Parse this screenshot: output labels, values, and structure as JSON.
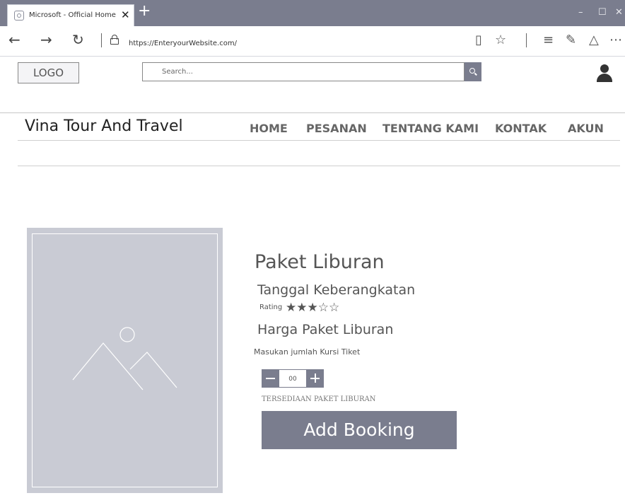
{
  "browser": {
    "tab_title": "Microsoft - Official Home",
    "tab_close": "✕",
    "new_tab": "+",
    "url": "https://EnteryourWebsite.com/",
    "window_controls": [
      "–",
      "☐",
      "✕"
    ],
    "icons": [
      "back-arrow-icon",
      "forward-arrow-icon",
      "refresh-icon",
      "lock-icon",
      "reading-view-icon",
      "favorite-star-icon",
      "hub-icon",
      "web-note-icon",
      "share-icon",
      "more-icon"
    ]
  },
  "header": {
    "logo": "LOGO",
    "search_placeholder": "Search...",
    "icons": [
      "search-icon",
      "user-icon"
    ]
  },
  "nav": {
    "brand": "Vina Tour And Travel",
    "items": [
      "HOME",
      "PESANAN",
      "TENTANG KAMI",
      "KONTAK",
      "AKUN"
    ]
  },
  "product": {
    "image_icon": "image-placeholder-icon",
    "title": "Paket Liburan",
    "date_label": "Tanggal Keberangkatan",
    "rating_label": "Rating",
    "rating": 3,
    "rating_max": 5,
    "price_label": "Harga Paket Liburan",
    "quantity_label": "Masukan jumlah Kursi Tiket",
    "quantity_value": "00",
    "availability": "TERSEDIAAN PAKET LIBURAN",
    "add_button": "Add Booking"
  },
  "colors": {
    "accent": "#7a7d8e",
    "image_placeholder": "#c9cbd4"
  }
}
